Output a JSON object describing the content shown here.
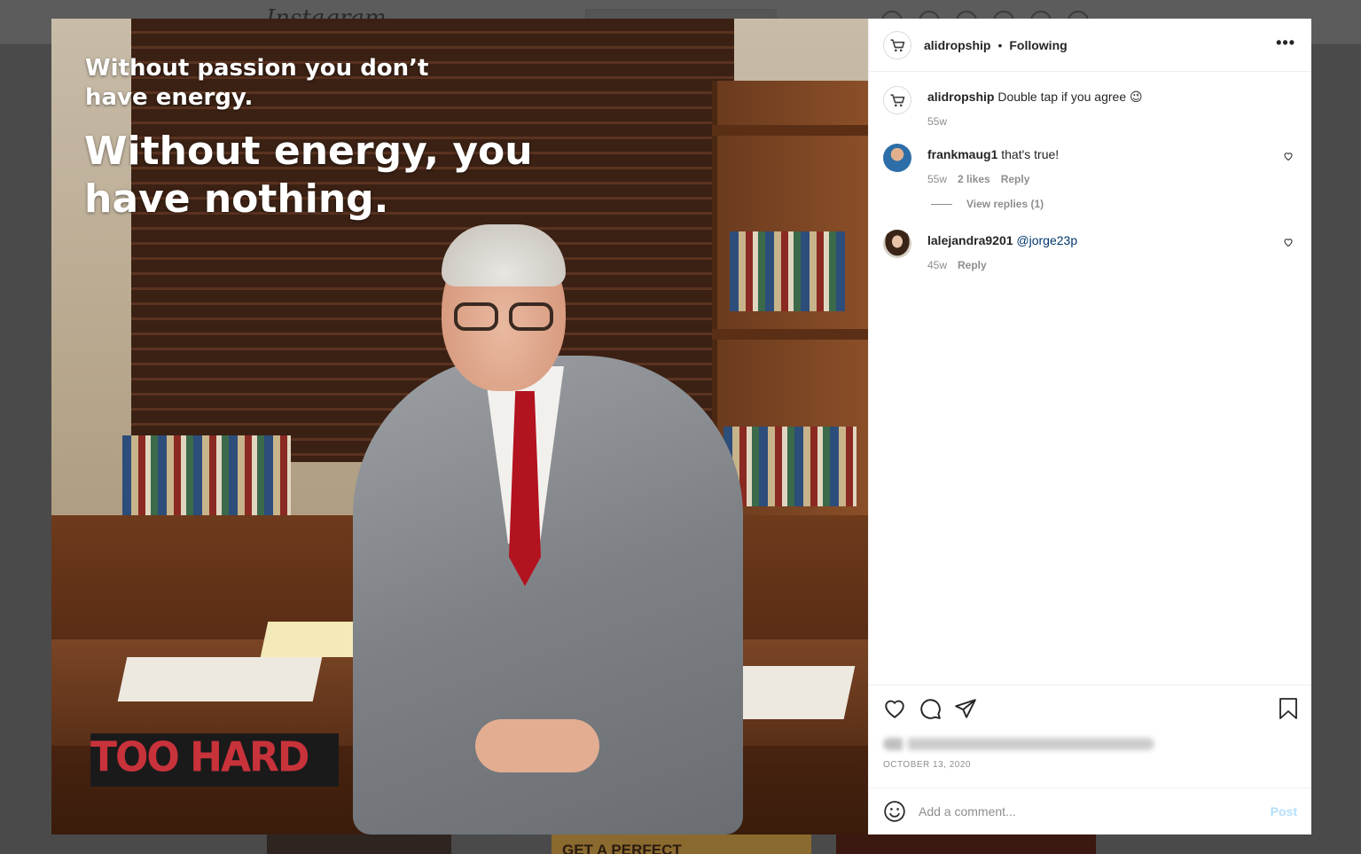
{
  "background": {
    "logo": "Instagram",
    "tile_text": "GET A PERFECT"
  },
  "post": {
    "image": {
      "quote_small": "Without passion you don’t have energy.",
      "quote_big": "Without energy, you have nothing.",
      "sign_text": "TOO HARD"
    },
    "header": {
      "username": "alidropship",
      "separator": "•",
      "follow_status": "Following",
      "more_label": "•••"
    },
    "caption": {
      "username": "alidropship",
      "text": "Double tap if you agree 😉",
      "age": "55w"
    },
    "comments": [
      {
        "username": "frankmaug1",
        "text": "that's true!",
        "age": "55w",
        "likes": "2 likes",
        "reply_label": "Reply",
        "view_replies": "View replies (1)"
      },
      {
        "username": "lalejandra9201",
        "mention": "@jorge23p",
        "age": "45w",
        "reply_label": "Reply"
      }
    ],
    "date": "OCTOBER 13, 2020",
    "add_comment": {
      "placeholder": "Add a comment...",
      "post_label": "Post"
    }
  },
  "icons": {
    "like": "heart-icon",
    "comment": "comment-bubble-icon",
    "share": "paper-plane-icon",
    "save": "bookmark-icon",
    "emoji": "smiley-icon",
    "more": "ellipsis-icon"
  },
  "colors": {
    "text": "#262626",
    "secondary": "#8e8e8e",
    "link": "#00376b",
    "post_disabled": "#b2dffc"
  }
}
